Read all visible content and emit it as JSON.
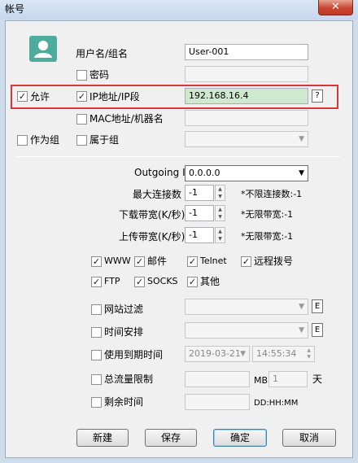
{
  "window": {
    "title": "帐号",
    "close_label": "✕"
  },
  "form": {
    "username_label": "用户名/组名",
    "username_value": "User-001",
    "password_label": "密码",
    "allow_label": "允许",
    "ip_label": "IP地址/IP段",
    "ip_value": "192.168.16.4",
    "help_label": "?",
    "mac_label": "MAC地址/机器名",
    "as_group_label": "作为组",
    "member_of_label": "属于组",
    "outgoing_ip_label": "Outgoing IP",
    "outgoing_ip_value": "0.0.0.0",
    "max_conn_label": "最大连接数",
    "max_conn_value": "-1",
    "max_conn_hint": "*不限连接数:-1",
    "download_label": "下载带宽(K/秒)",
    "download_value": "-1",
    "download_hint": "*无限带宽:-1",
    "upload_label": "上传带宽(K/秒)",
    "upload_value": "-1",
    "upload_hint": "*无限带宽:-1"
  },
  "services": {
    "www": "WWW",
    "mail": "邮件",
    "telnet": "Telnet",
    "remote_dial": "远程拨号",
    "ftp": "FTP",
    "socks": "SOCKS",
    "other": "其他"
  },
  "filters": {
    "site_filter_label": "网站过滤",
    "schedule_label": "时间安排",
    "expiry_label": "使用到期时间",
    "expiry_date": "2019-03-21",
    "expiry_time": "14:55:34",
    "traffic_label": "总流量限制",
    "traffic_unit": "MB",
    "traffic_days": "1",
    "traffic_day_unit": "天",
    "remaining_label": "剩余时间",
    "remaining_format": "DD:HH:MM",
    "edit_label": "E"
  },
  "buttons": {
    "new": "新建",
    "save": "保存",
    "ok": "确定",
    "cancel": "取消"
  },
  "colors": {
    "highlight_border": "#d9363a",
    "avatar": "#4eac9c",
    "ip_field": "#cfe9cf"
  }
}
